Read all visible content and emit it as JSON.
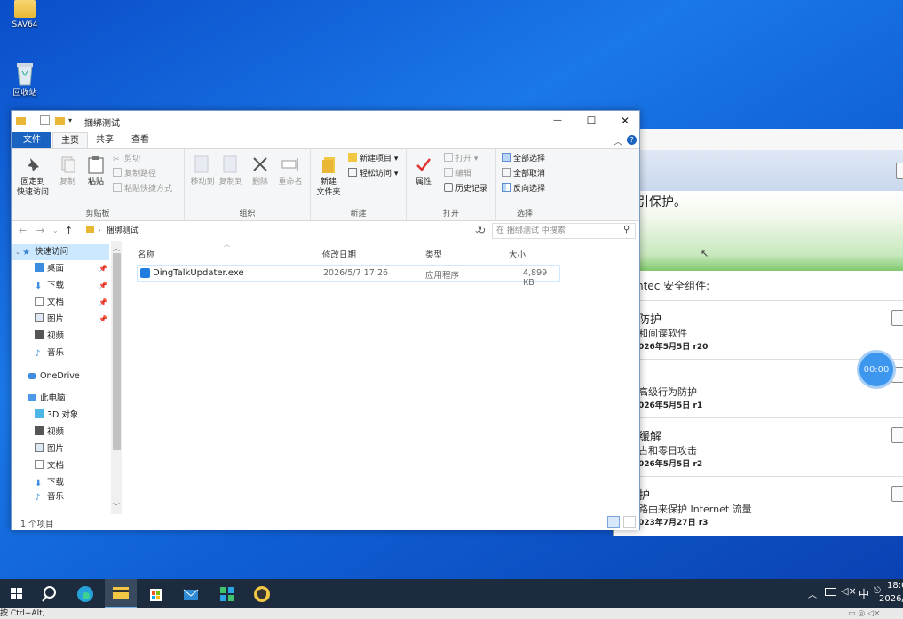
{
  "desktop": {
    "icons": [
      {
        "label": "SAV64"
      },
      {
        "label": "回收站"
      }
    ]
  },
  "background_window": {
    "partial_heading": "引保护。",
    "components_label": "ntec 安全组件:",
    "timer": "00:00",
    "rows": [
      {
        "title": "防护",
        "subtitle": "和间谍软件",
        "date": "026年5月5日 r20"
      },
      {
        "title": "",
        "subtitle": "高级行为防护",
        "date": "026年5月5日 r1"
      },
      {
        "title": "缓解",
        "subtitle": "占和零日攻击",
        "date": "026年5月5日 r2"
      },
      {
        "title": "护",
        "subtitle": "路由来保护 Internet 流量",
        "date": "023年7月27日 r3"
      }
    ]
  },
  "explorer": {
    "title": "捆绑测试",
    "window_buttons": {
      "minimize": "—",
      "maximize": "☐",
      "close": "✕"
    },
    "tabs": [
      "文件",
      "主页",
      "共享",
      "查看"
    ],
    "ribbon": {
      "clipboard": {
        "label": "剪贴板",
        "pin": "固定到\n快速访问",
        "copy": "复制",
        "paste": "粘贴",
        "cut": "剪切",
        "copy_path": "复制路径",
        "paste_shortcut": "粘贴快捷方式"
      },
      "organize": {
        "label": "组织",
        "move_to": "移动到",
        "copy_to": "复制到",
        "delete": "删除",
        "rename": "重命名"
      },
      "new": {
        "label": "新建",
        "new_folder": "新建\n文件夹",
        "new_item": "新建项目 ▾",
        "easy_access": "轻松访问 ▾"
      },
      "open": {
        "label": "打开",
        "properties": "属性",
        "open": "打开 ▾",
        "edit": "编辑",
        "history": "历史记录"
      },
      "select": {
        "label": "选择",
        "select_all": "全部选择",
        "select_none": "全部取消",
        "invert": "反向选择"
      }
    },
    "address": {
      "path": "捆绑测试",
      "search_placeholder": "在 捆绑测试 中搜索"
    },
    "nav": {
      "quick_access": "快速访问",
      "quick_items": [
        "桌面",
        "下载",
        "文档",
        "图片",
        "视频",
        "音乐"
      ],
      "onedrive": "OneDrive",
      "this_pc": "此电脑",
      "pc_items": [
        "3D 对象",
        "视频",
        "图片",
        "文档",
        "下载",
        "音乐"
      ]
    },
    "columns": {
      "name": "名称",
      "date": "修改日期",
      "type": "类型",
      "size": "大小"
    },
    "files": [
      {
        "name": "DingTalkUpdater.exe",
        "date": "2026/5/7 17:26",
        "type": "应用程序",
        "size": "4,899 KB"
      }
    ],
    "status": "1 个项目"
  },
  "taskbar": {
    "clock": "18:0",
    "date": "2026/",
    "ime": "中"
  },
  "bottom_strip": "按 Ctrl+Alt,"
}
